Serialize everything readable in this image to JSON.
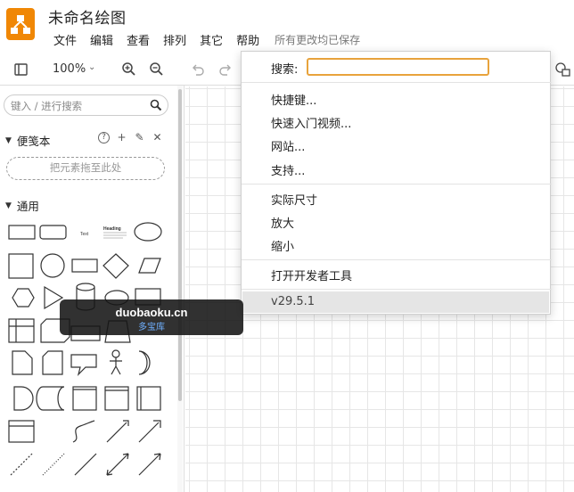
{
  "app": {
    "title": "未命名绘图",
    "menu": [
      "文件",
      "编辑",
      "查看",
      "排列",
      "其它",
      "帮助"
    ],
    "save_status": "所有更改均已保存"
  },
  "toolbar": {
    "zoom": "100%"
  },
  "sidebar": {
    "search_placeholder": "键入 / 进行搜索",
    "scratchpad": {
      "title": "便笺本",
      "tools": [
        "?",
        "+",
        "✎",
        "✕"
      ],
      "dropzone": "把元素拖至此处"
    },
    "general": {
      "title": "通用",
      "shape_text": {
        "text": "Text",
        "heading": "Heading"
      }
    }
  },
  "help_menu": {
    "search_label": "搜索:",
    "search_value": "",
    "items_group1": [
      "快捷键...",
      "快速入门视频...",
      "网站...",
      "支持..."
    ],
    "items_group2": [
      "实际尺寸",
      "放大",
      "缩小"
    ],
    "items_group3": [
      "打开开发者工具"
    ],
    "version": "v29.5.1"
  },
  "watermark": {
    "main": "duobaoku.cn",
    "sub": "多宝库"
  },
  "colors": {
    "logo": "#f08705",
    "search_focus": "#e8a33c"
  }
}
